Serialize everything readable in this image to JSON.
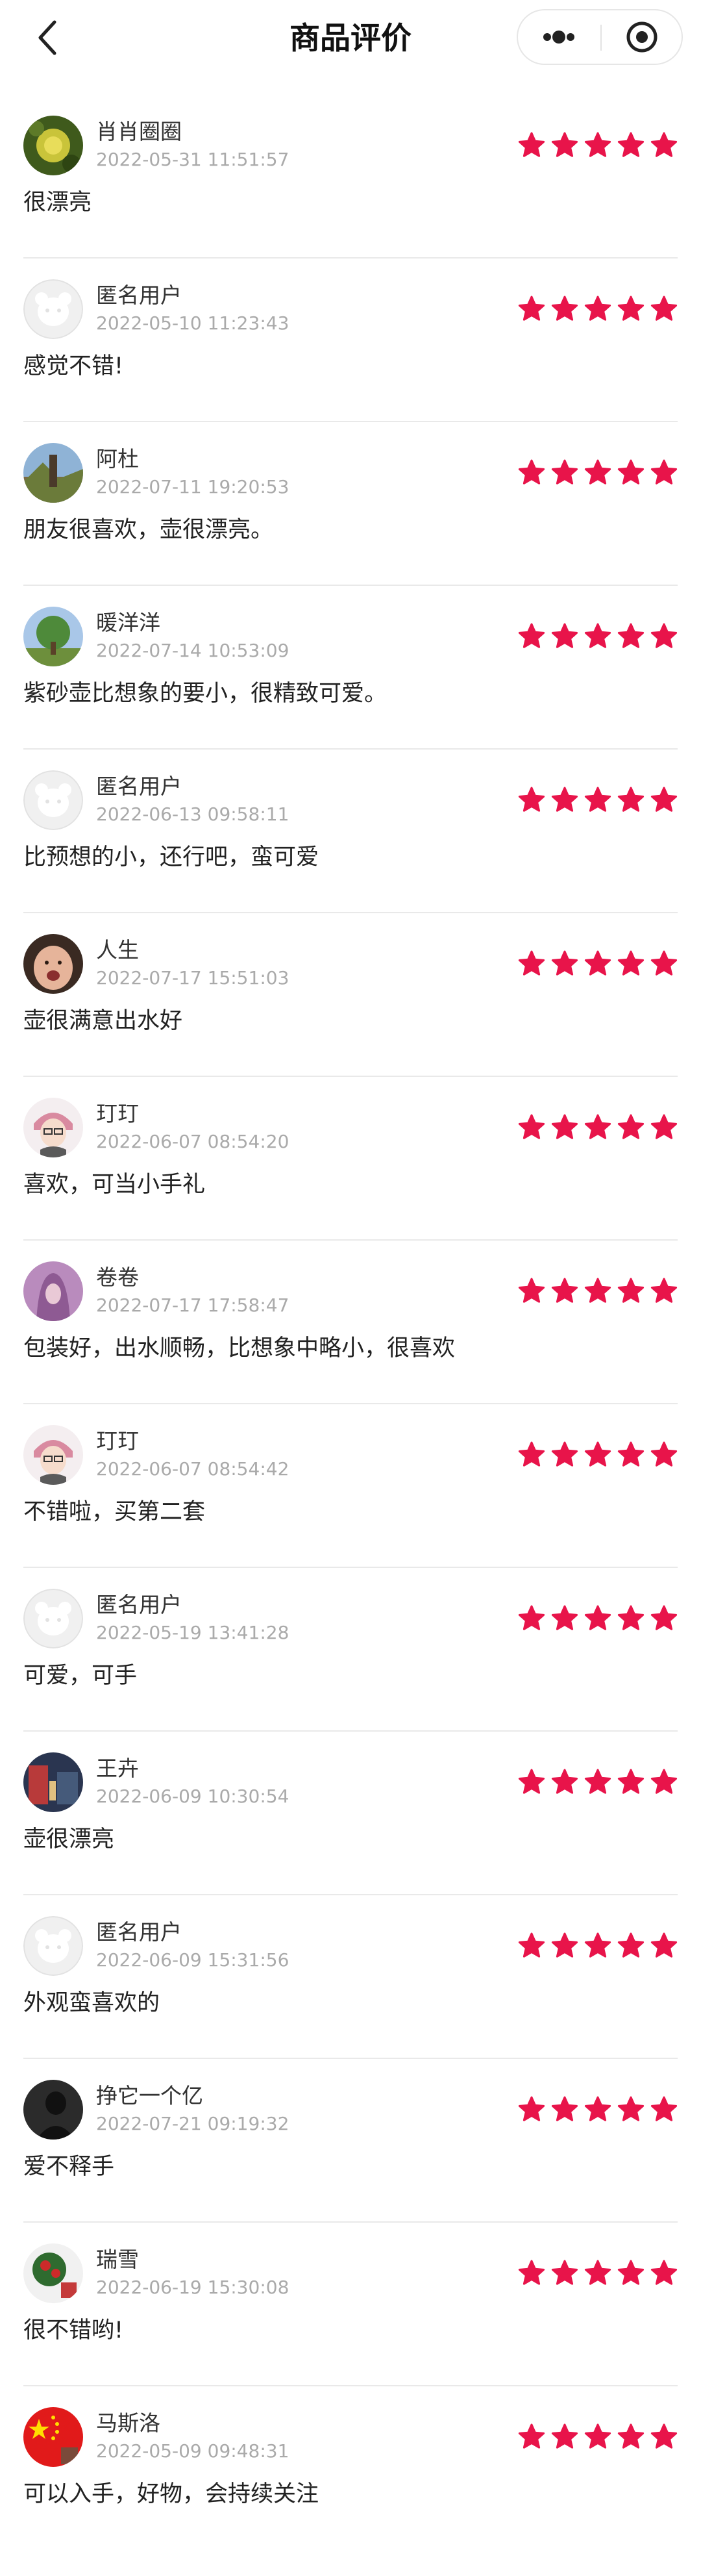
{
  "nav": {
    "title": "商品评价"
  },
  "colors": {
    "star": "#e8144a",
    "divider": "#e9e9e9",
    "time": "#aaaaaa"
  },
  "reviews": [
    {
      "user": "肖肖圈圈",
      "time": "2022-05-31 11:51:57",
      "content": "很漂亮",
      "rating": 5,
      "avatar": "flower"
    },
    {
      "user": "匿名用户",
      "time": "2022-05-10 11:23:43",
      "content": "感觉不错!",
      "rating": 5,
      "avatar": "anonymous"
    },
    {
      "user": "阿杜",
      "time": "2022-07-11 19:20:53",
      "content": "朋友很喜欢，壶很漂亮。",
      "rating": 5,
      "avatar": "landscape"
    },
    {
      "user": "暖洋洋",
      "time": "2022-07-14 10:53:09",
      "content": "紫砂壶比想象的要小，很精致可爱。",
      "rating": 5,
      "avatar": "tree"
    },
    {
      "user": "匿名用户",
      "time": "2022-06-13 09:58:11",
      "content": "比预想的小，还行吧，蛮可爱",
      "rating": 5,
      "avatar": "anonymous"
    },
    {
      "user": "人生",
      "time": "2022-07-17 15:51:03",
      "content": "壶很满意出水好",
      "rating": 5,
      "avatar": "baby"
    },
    {
      "user": "玎玎",
      "time": "2022-06-07 08:54:20",
      "content": "喜欢，可当小手礼",
      "rating": 5,
      "avatar": "girl"
    },
    {
      "user": "卷卷",
      "time": "2022-07-17 17:58:47",
      "content": "包装好，出水顺畅，比想象中略小，很喜欢",
      "rating": 5,
      "avatar": "purple"
    },
    {
      "user": "玎玎",
      "time": "2022-06-07 08:54:42",
      "content": "不错啦，买第二套",
      "rating": 5,
      "avatar": "girl"
    },
    {
      "user": "匿名用户",
      "time": "2022-05-19 13:41:28",
      "content": "可爱，可手",
      "rating": 5,
      "avatar": "anonymous"
    },
    {
      "user": "王卉",
      "time": "2022-06-09 10:30:54",
      "content": "壶很漂亮",
      "rating": 5,
      "avatar": "street"
    },
    {
      "user": "匿名用户",
      "time": "2022-06-09 15:31:56",
      "content": "外观蛮喜欢的",
      "rating": 5,
      "avatar": "anonymous"
    },
    {
      "user": "挣它一个亿",
      "time": "2022-07-21 09:19:32",
      "content": "爱不释手",
      "rating": 5,
      "avatar": "dark"
    },
    {
      "user": "瑞雪",
      "time": "2022-06-19 15:30:08",
      "content": "很不错哟!",
      "rating": 5,
      "avatar": "christmas"
    },
    {
      "user": "马斯洛",
      "time": "2022-05-09 09:48:31",
      "content": "可以入手，好物，会持续关注",
      "rating": 5,
      "avatar": "flag"
    }
  ]
}
